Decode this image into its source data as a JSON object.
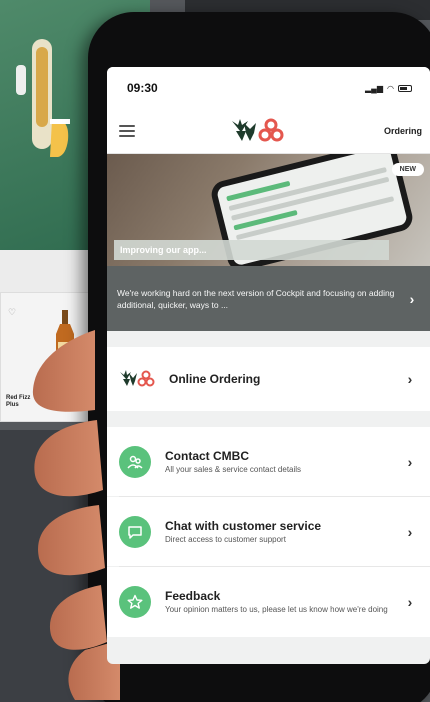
{
  "status_bar": {
    "time": "09:30"
  },
  "header": {
    "ordering_label": "Ordering"
  },
  "banner": {
    "badge": "NEW",
    "title": "Improving our app...",
    "description": "We're working hard on the next version of Cockpit and focusing on adding additional, quicker, ways to ..."
  },
  "menu_items": [
    {
      "title": "Online Ordering",
      "subtitle": ""
    },
    {
      "title": "Contact CMBC",
      "subtitle": "All your sales & service contact details"
    },
    {
      "title": "Chat with customer service",
      "subtitle": "Direct access to customer support"
    },
    {
      "title": "Feedback",
      "subtitle": "Your opinion matters to us, please let us know how we're doing"
    }
  ],
  "background": {
    "product_label": "Red Fizz Plus"
  },
  "colors": {
    "accent_green": "#5ac27c",
    "brand_dark_green": "#1f3b2c",
    "brand_red": "#e4574e"
  },
  "icons": [
    "menu-icon",
    "signal-icon",
    "wifi-icon",
    "battery-icon",
    "brand-logo",
    "people-icon",
    "chat-icon",
    "star-icon",
    "chevron-right-icon"
  ]
}
